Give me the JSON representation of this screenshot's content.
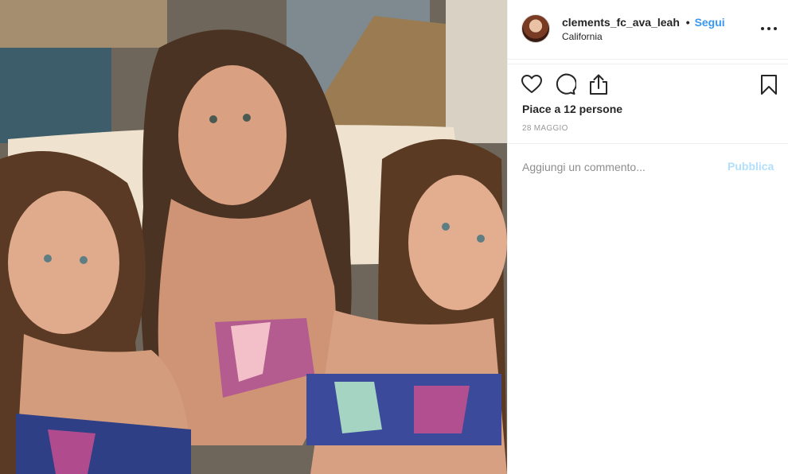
{
  "post": {
    "username": "clements_fc_ava_leah",
    "separator": "•",
    "follow_label": "Segui",
    "location": "California",
    "likes_text": "Piace a 12 persone",
    "date": "28 MAGGIO",
    "comment_placeholder": "Aggiungi un commento...",
    "publish_label": "Pubblica"
  },
  "icons": {
    "more": "more-options-icon",
    "like": "heart-icon",
    "comment": "comment-icon",
    "share": "share-icon",
    "save": "bookmark-icon"
  },
  "colors": {
    "accent": "#3897f0",
    "publish_disabled": "#b2dffc",
    "text": "#262626",
    "muted": "#8e8e8e",
    "border": "#efefef"
  }
}
